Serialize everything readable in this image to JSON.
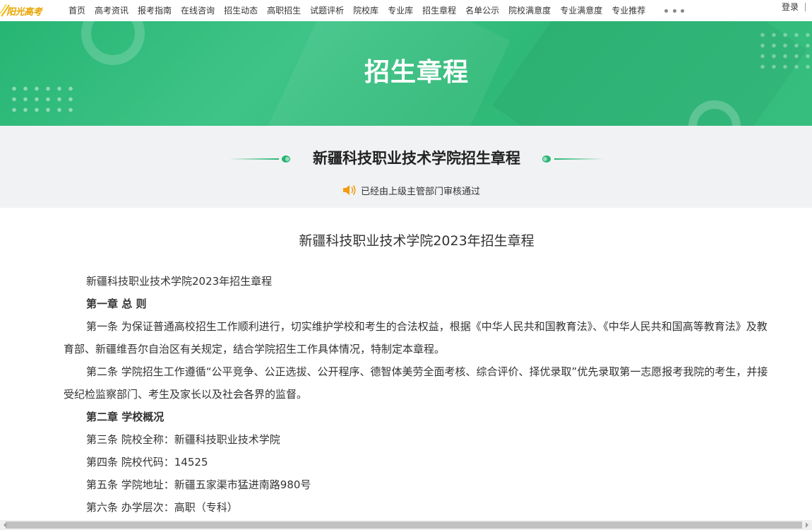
{
  "nav": {
    "logo_text": "阳光高考",
    "items": [
      {
        "label": "首页"
      },
      {
        "label": "高考资讯"
      },
      {
        "label": "报考指南"
      },
      {
        "label": "在线咨询"
      },
      {
        "label": "招生动态"
      },
      {
        "label": "高职招生"
      },
      {
        "label": "试题评析"
      },
      {
        "label": "院校库"
      },
      {
        "label": "专业库"
      },
      {
        "label": "招生章程"
      },
      {
        "label": "名单公示"
      },
      {
        "label": "院校满意度"
      },
      {
        "label": "专业满意度"
      },
      {
        "label": "专业推荐"
      }
    ],
    "more_icon": "ellipsis-icon",
    "login_label": "登录"
  },
  "banner": {
    "title": "招生章程"
  },
  "header": {
    "school_title": "新疆科技职业技术学院招生章程",
    "audit_icon": "speaker-icon",
    "audit_text": "已经由上级主管部门审核通过"
  },
  "article": {
    "title": "新疆科技职业技术学院2023年招生章程",
    "paragraphs": [
      {
        "text": "新疆科技职业技术学院2023年招生章程",
        "bold": false
      },
      {
        "text": "第一章 总 则",
        "bold": true
      },
      {
        "text": "第一条 为保证普通高校招生工作顺利进行，切实维护学校和考生的合法权益，根据《中华人民共和国教育法》、《中华人民共和国高等教育法》及教育部、新疆维吾尔自治区有关规定，结合学院招生工作具体情况，特制定本章程。",
        "bold": false
      },
      {
        "text": "第二条 学院招生工作遵循“公平竞争、公正选拔、公开程序、德智体美劳全面考核、综合评价、择优录取”优先录取第一志愿报考我院的考生，并接受纪检监察部门、考生及家长以及社会各界的监督。",
        "bold": false
      },
      {
        "text": "第二章  学校概况",
        "bold": true
      },
      {
        "text": "第三条 院校全称：新疆科技职业技术学院",
        "bold": false
      },
      {
        "text": "第四条 院校代码：14525",
        "bold": false
      },
      {
        "text": "第五条 学院地址：新疆五家渠市猛进南路980号",
        "bold": false
      },
      {
        "text": "第六条 办学层次：高职（专科）",
        "bold": false
      }
    ]
  },
  "colors": {
    "brand_green": "#25b574",
    "logo_gold": "#e9a400",
    "speaker_orange": "#f39c12"
  }
}
